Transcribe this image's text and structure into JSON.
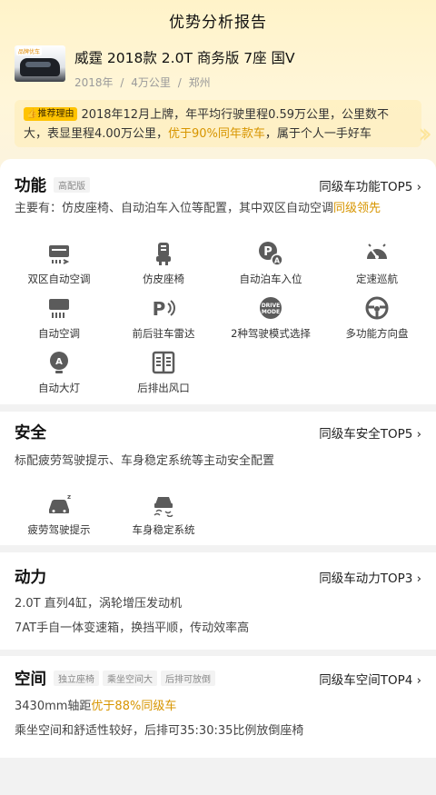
{
  "page_title": "优势分析报告",
  "car": {
    "thumb_brand": "品牌优车",
    "name": "威霆 2018款 2.0T 商务版 7座 国V",
    "year": "2018年",
    "mileage": "4万公里",
    "city": "郑州",
    "sep": "/"
  },
  "reason": {
    "badge": "推荐理由",
    "text_before": "2018年12月上牌，年平均行驶里程0.59万公里，公里数不大，表显里程4.00万公里，",
    "highlight": "优于90%同年款车",
    "text_after": "，属于个人一手好车"
  },
  "sections": {
    "function": {
      "title": "功能",
      "tag": "高配版",
      "top_link": "同级车功能TOP5 ›",
      "desc_before": "主要有：仿皮座椅、自动泊车入位等配置，其中双区自动空调",
      "desc_highlight": "同级领先",
      "features": [
        {
          "label": "双区自动空调",
          "icon": "dual-zone-ac-icon"
        },
        {
          "label": "仿皮座椅",
          "icon": "leather-seat-icon"
        },
        {
          "label": "自动泊车入位",
          "icon": "auto-parking-icon"
        },
        {
          "label": "定速巡航",
          "icon": "cruise-control-icon"
        },
        {
          "label": "自动空调",
          "icon": "auto-ac-icon"
        },
        {
          "label": "前后驻车雷达",
          "icon": "parking-radar-icon"
        },
        {
          "label": "2种驾驶模式选择",
          "icon": "drive-mode-icon"
        },
        {
          "label": "多功能方向盘",
          "icon": "steering-wheel-icon"
        },
        {
          "label": "自动大灯",
          "icon": "auto-headlight-icon"
        },
        {
          "label": "后排出风口",
          "icon": "rear-vent-icon"
        }
      ],
      "drive_mode_text": "DRIVE MODE",
      "parking_letter": "P",
      "auto_letter": "A"
    },
    "safety": {
      "title": "安全",
      "top_link": "同级车安全TOP5 ›",
      "desc": "标配疲劳驾驶提示、车身稳定系统等主动安全配置",
      "features": [
        {
          "label": "疲劳驾驶提示",
          "icon": "fatigue-warning-icon"
        },
        {
          "label": "车身稳定系统",
          "icon": "stability-control-icon"
        }
      ]
    },
    "power": {
      "title": "动力",
      "top_link": "同级车动力TOP3 ›",
      "line1": "2.0T 直列4缸，涡轮增压发动机",
      "line2": "7AT手自一体变速箱，换挡平顺，传动效率高"
    },
    "space": {
      "title": "空间",
      "tags": [
        "独立座椅",
        "乘坐空间大",
        "后排可放倒"
      ],
      "top_link": "同级车空间TOP4 ›",
      "line1_before": "3430mm轴距",
      "line1_highlight": "优于88%同级车",
      "line2": "乘坐空间和舒适性较好，后排可35:30:35比例放倒座椅"
    }
  },
  "colors": {
    "accent": "#ffc300",
    "highlight": "#d79500",
    "icon_gray": "#5b5b5b"
  }
}
